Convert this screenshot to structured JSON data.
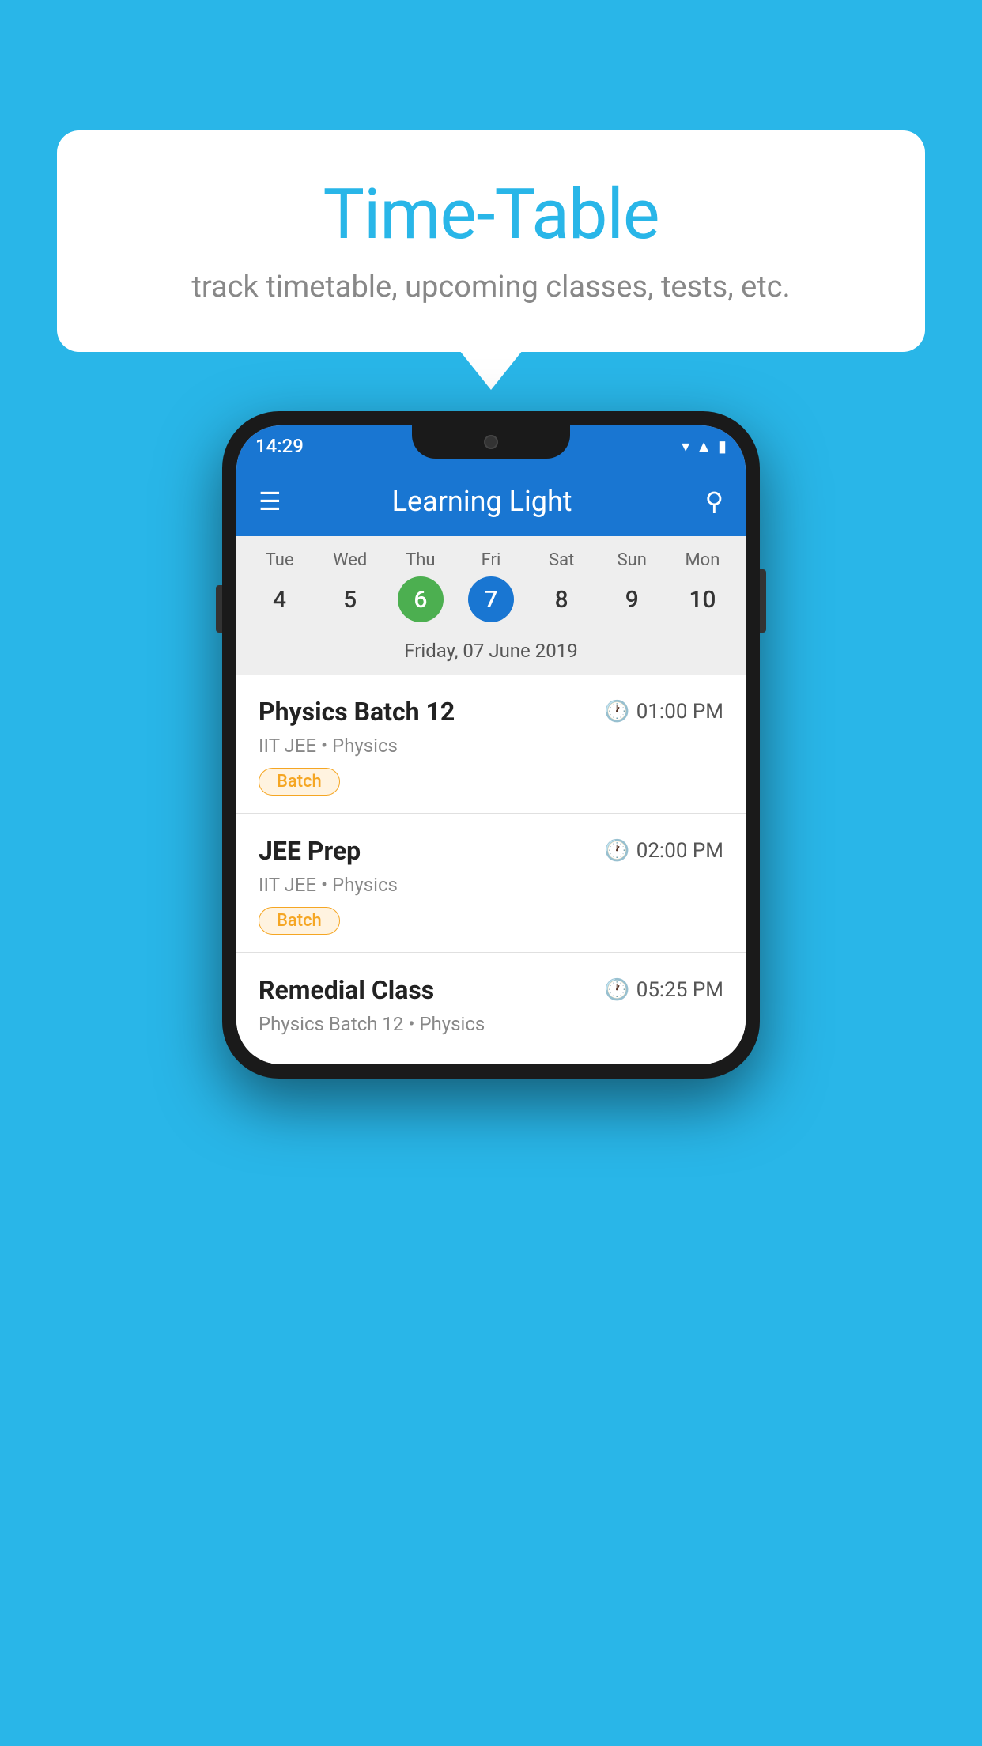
{
  "background_color": "#29B6E8",
  "speech_bubble": {
    "title": "Time-Table",
    "subtitle": "track timetable, upcoming classes, tests, etc."
  },
  "phone": {
    "status_bar": {
      "time": "14:29",
      "icons": [
        "▾▴",
        "◂▸",
        "▮"
      ]
    },
    "app_bar": {
      "menu_icon": "menu-icon",
      "title": "Learning Light",
      "search_icon": "search-icon"
    },
    "calendar": {
      "days": [
        {
          "label": "Tue",
          "number": "4",
          "state": "normal"
        },
        {
          "label": "Wed",
          "number": "5",
          "state": "normal"
        },
        {
          "label": "Thu",
          "number": "6",
          "state": "today"
        },
        {
          "label": "Fri",
          "number": "7",
          "state": "selected"
        },
        {
          "label": "Sat",
          "number": "8",
          "state": "normal"
        },
        {
          "label": "Sun",
          "number": "9",
          "state": "normal"
        },
        {
          "label": "Mon",
          "number": "10",
          "state": "normal"
        }
      ],
      "selected_date_label": "Friday, 07 June 2019"
    },
    "events": [
      {
        "title": "Physics Batch 12",
        "time": "01:00 PM",
        "meta": "IIT JEE • Physics",
        "badge": "Batch"
      },
      {
        "title": "JEE Prep",
        "time": "02:00 PM",
        "meta": "IIT JEE • Physics",
        "badge": "Batch"
      },
      {
        "title": "Remedial Class",
        "time": "05:25 PM",
        "meta": "Physics Batch 12 • Physics",
        "badge": null
      }
    ]
  }
}
